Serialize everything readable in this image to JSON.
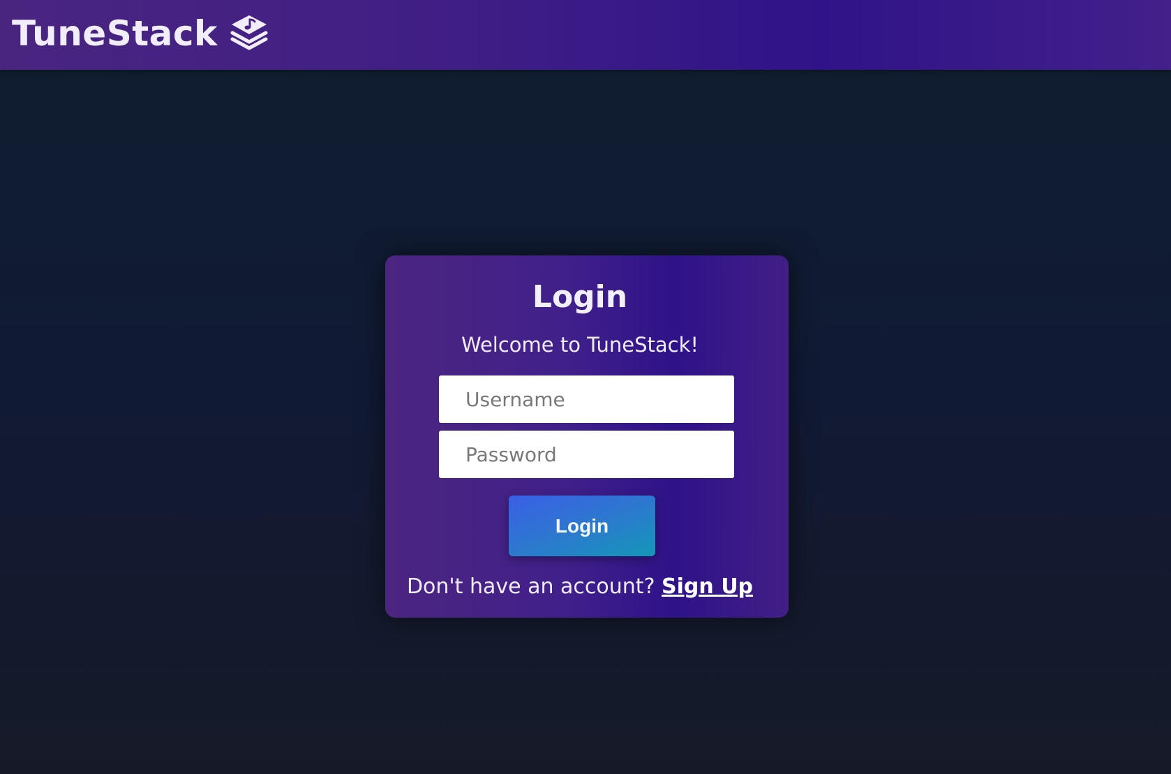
{
  "header": {
    "brand_name": "TuneStack",
    "logo_icon": "stacked-music-icon"
  },
  "login_card": {
    "title": "Login",
    "welcome_text": "Welcome to TuneStack!",
    "username_placeholder": "Username",
    "username_value": "",
    "password_placeholder": "Password",
    "password_value": "",
    "login_button_label": "Login",
    "signup_prompt": "Don't have an account?",
    "signup_link_label": "Sign Up"
  },
  "colors": {
    "header_gradient": [
      "#4a2580",
      "#2f1388"
    ],
    "card_gradient": [
      "#4c2580",
      "#2e1288"
    ],
    "button_gradient": [
      "#3a5fe6",
      "#1497b8"
    ],
    "page_background": "#111a35"
  }
}
